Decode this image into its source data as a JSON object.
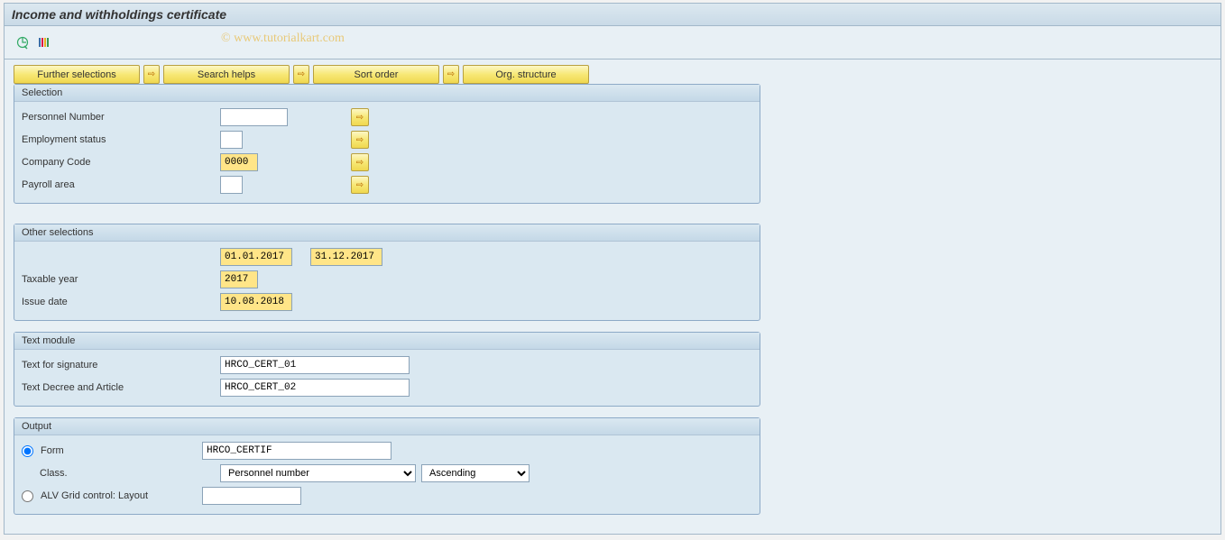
{
  "title": "Income and withholdings certificate",
  "watermark": "© www.tutorialkart.com",
  "toolbar": {
    "execute_icon": "⊕",
    "variant_icon": "≡"
  },
  "buttons": {
    "further_selections": "Further selections",
    "search_helps": "Search helps",
    "sort_order": "Sort order",
    "org_structure": "Org. structure"
  },
  "selection": {
    "header": "Selection",
    "personnel_number": {
      "label": "Personnel Number",
      "value": ""
    },
    "employment_status": {
      "label": "Employment status",
      "value": ""
    },
    "company_code": {
      "label": "Company Code",
      "value": "0000"
    },
    "payroll_area": {
      "label": "Payroll area",
      "value": ""
    }
  },
  "other_selections": {
    "header": "Other selections",
    "date_from": "01.01.2017",
    "date_to": "31.12.2017",
    "taxable_year": {
      "label": "Taxable year",
      "value": "2017"
    },
    "issue_date": {
      "label": "Issue date",
      "value": "10.08.2018"
    }
  },
  "text_module": {
    "header": "Text module",
    "text_signature": {
      "label": "Text for signature",
      "value": "HRCO_CERT_01"
    },
    "text_decree": {
      "label": "Text Decree and Article",
      "value": "HRCO_CERT_02"
    }
  },
  "output": {
    "header": "Output",
    "form": {
      "label": "Form",
      "value": "HRCO_CERTIF"
    },
    "class": {
      "label": "Class.",
      "value": "Personnel number",
      "order": "Ascending"
    },
    "alv": {
      "label": "ALV Grid control: Layout",
      "value": ""
    }
  }
}
